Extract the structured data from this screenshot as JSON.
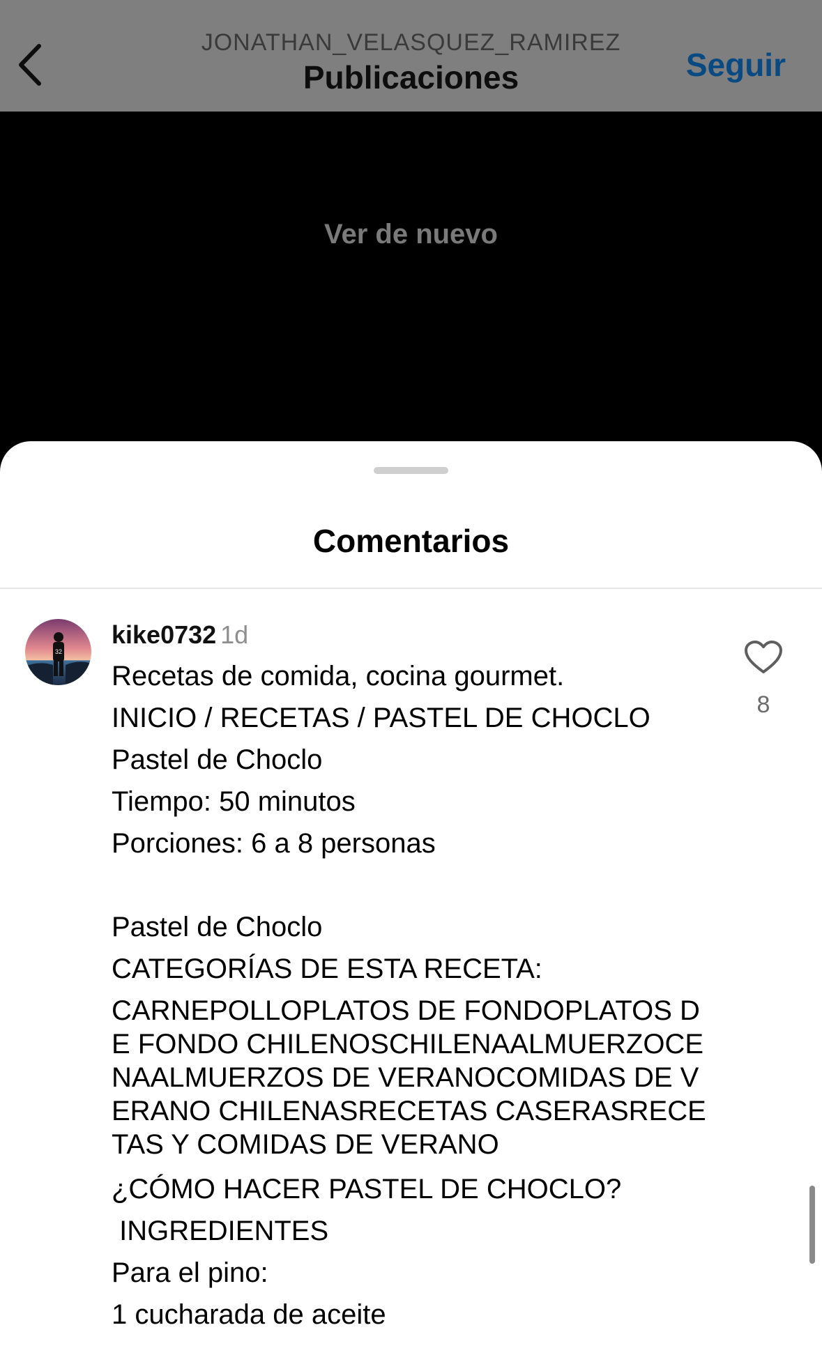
{
  "header": {
    "username": "JONATHAN_VELASQUEZ_RAMIREZ",
    "title": "Publicaciones",
    "follow_label": "Seguir",
    "back_icon": "chevron-left-icon"
  },
  "media": {
    "replay_label": "Ver de nuevo"
  },
  "sheet": {
    "title": "Comentarios"
  },
  "comment": {
    "username": "kike0732",
    "time": "1d",
    "likes": "8",
    "lines": [
      "Recetas de comida, cocina gourmet.",
      "INICIO / RECETAS / PASTEL DE CHOCLO",
      "Pastel de Choclo",
      "Tiempo: 50 minutos",
      "Porciones: 6 a 8 personas",
      "",
      "Pastel de Choclo",
      "CATEGORÍAS DE ESTA RECETA:",
      "CARNEPOLLOPLATOS DE FONDOPLATOS DE FONDO CHILENOSCHILENAALMUERZOCENAALMUERZOS DE VERANOCOMIDAS DE VERANO CHILENASRECETAS CASERASRECETAS Y COMIDAS DE VERANO",
      "¿CÓMO HACER PASTEL DE CHOCLO?",
      " INGREDIENTES",
      "Para el pino:",
      "1 cucharada de aceite"
    ]
  },
  "colors": {
    "header_bg": "#7f7f7f",
    "follow": "#0a4a82",
    "sheet_bg": "#ffffff",
    "muted": "#8e8e8e"
  }
}
